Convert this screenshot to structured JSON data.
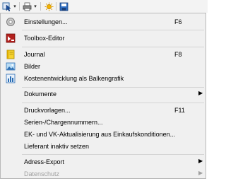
{
  "toolbar": {
    "buttons": [
      "cursor-icon",
      "printer-icon",
      "dropdown-arrow",
      "sun-icon",
      "save-icon"
    ]
  },
  "menu": {
    "items": [
      {
        "label": "Einstellungen...",
        "shortcut": "F6",
        "icon": "gear-disc-icon"
      },
      {
        "label": "Toolbox-Editor",
        "icon": "toolbox-icon"
      },
      {
        "label": "Journal",
        "shortcut": "F8",
        "icon": "journal-icon"
      },
      {
        "label": "Bilder",
        "icon": "pictures-icon"
      },
      {
        "label": "Kostenentwicklung als Balkengrafik",
        "icon": "bar-chart-icon"
      },
      {
        "label": "Dokumente",
        "submenu": true
      },
      {
        "label": "Druckvorlagen...",
        "shortcut": "F11"
      },
      {
        "label": "Serien-/Chargennummern..."
      },
      {
        "label": "EK- und VK-Aktualisierung aus Einkaufskonditionen..."
      },
      {
        "label": "Lieferant inaktiv setzen"
      },
      {
        "label": "Adress-Export",
        "submenu": true
      },
      {
        "label": "Datenschutz",
        "submenu": true,
        "disabled": true
      }
    ]
  },
  "colors": {
    "menu_background": "#f0f0f0",
    "disabled_text": "#a0a0a0",
    "separator": "#d4d4d4"
  }
}
